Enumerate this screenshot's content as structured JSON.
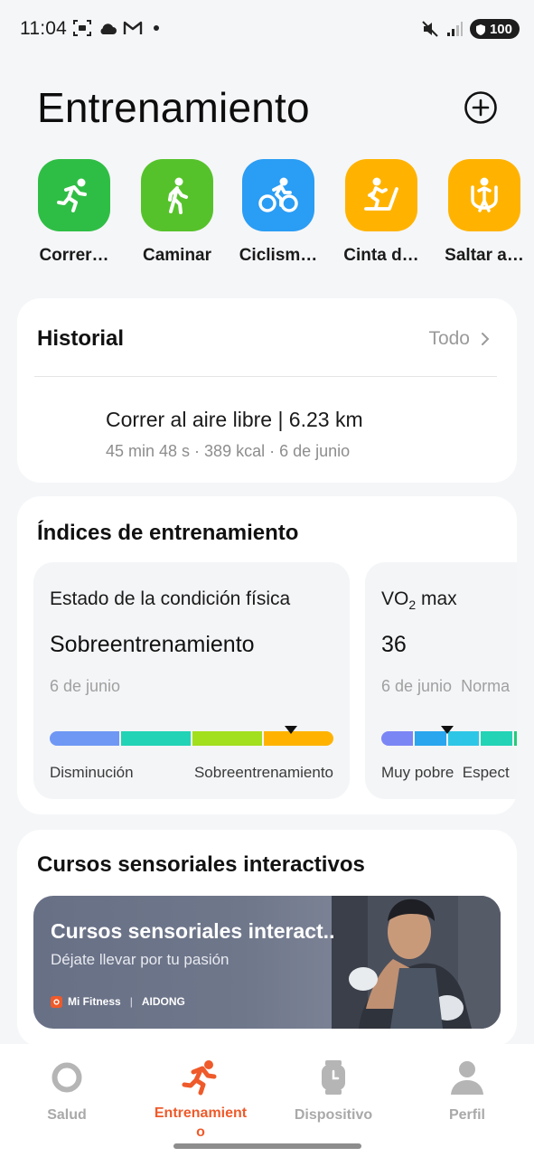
{
  "status_bar": {
    "time": "11:04",
    "battery": "100"
  },
  "header": {
    "title": "Entrenamiento"
  },
  "activities": [
    {
      "label": "Correr…",
      "color": "#2fbe45",
      "icon": "running-icon"
    },
    {
      "label": "Caminar",
      "color": "#56c22b",
      "icon": "walking-icon"
    },
    {
      "label": "Ciclism…",
      "color": "#2a9df4",
      "icon": "cycling-icon"
    },
    {
      "label": "Cinta d…",
      "color": "#ffb300",
      "icon": "treadmill-icon"
    },
    {
      "label": "Saltar a…",
      "color": "#ffb300",
      "icon": "jump-rope-icon"
    }
  ],
  "history": {
    "title": "Historial",
    "all_label": "Todo",
    "entry_main": "Correr al aire libre | 6.23 km",
    "entry_sub": "45 min 48 s · 389 kcal · 6 de junio"
  },
  "indices": {
    "title": "Índices de entrenamiento",
    "panels": [
      {
        "title": "Estado de la condición física",
        "value": "Sobreentrenamiento",
        "date": "6 de junio",
        "left_label": "Disminución",
        "right_label": "Sobreentrenamiento",
        "segment_colors": [
          "#6f98f5",
          "#22d3b5",
          "#a2df1d",
          "#ffb300"
        ],
        "marker_fraction": 0.85
      },
      {
        "title_prefix": "VO",
        "title_sub": "2",
        "title_suffix": " max",
        "value": "36",
        "date": "6 de junio  Norma",
        "left_label": "Muy pobre  Espect",
        "segment_colors": [
          "#7b86f5",
          "#2aa6ee",
          "#2ec6e6",
          "#22d3b5",
          "#22cc7a"
        ],
        "marker_fraction": 0.4
      }
    ]
  },
  "courses": {
    "title": "Cursos sensoriales interactivos",
    "banner_title": "Cursos sensoriales interact..",
    "banner_subtitle": "Déjate llevar por tu pasión",
    "brand_1": "Mi Fitness",
    "brand_sep": "|",
    "brand_2": "AIDONG"
  },
  "nav": {
    "items": [
      {
        "label": "Salud",
        "icon": "health-ring-icon",
        "active": false
      },
      {
        "label": "Entrenamient o",
        "icon": "running-icon",
        "active": true
      },
      {
        "label": "Dispositivo",
        "icon": "watch-icon",
        "active": false
      },
      {
        "label": "Perfil",
        "icon": "profile-icon",
        "active": false
      }
    ]
  },
  "colors": {
    "accent": "#ef5a2a",
    "background": "#f5f6f8"
  }
}
